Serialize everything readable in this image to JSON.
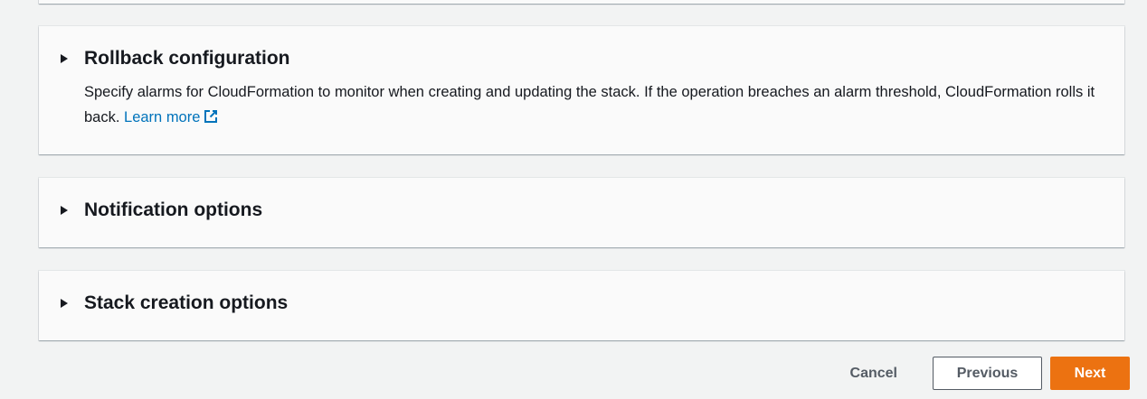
{
  "sections": {
    "rollback": {
      "title": "Rollback configuration",
      "description": "Specify alarms for CloudFormation to monitor when creating and updating the stack. If the operation breaches an alarm threshold, CloudFormation rolls it back.",
      "link_label": "Learn more",
      "link_icon": "external-link-icon",
      "expanded": false
    },
    "notification": {
      "title": "Notification options",
      "expanded": false
    },
    "stack_creation": {
      "title": "Stack creation options",
      "expanded": false
    }
  },
  "actions": {
    "cancel_label": "Cancel",
    "previous_label": "Previous",
    "next_label": "Next"
  },
  "colors": {
    "background": "#f2f3f3",
    "panel": "#fafafa",
    "link": "#0073bb",
    "primary_button": "#ec7211",
    "text": "#16191f",
    "secondary_text": "#545b64"
  }
}
